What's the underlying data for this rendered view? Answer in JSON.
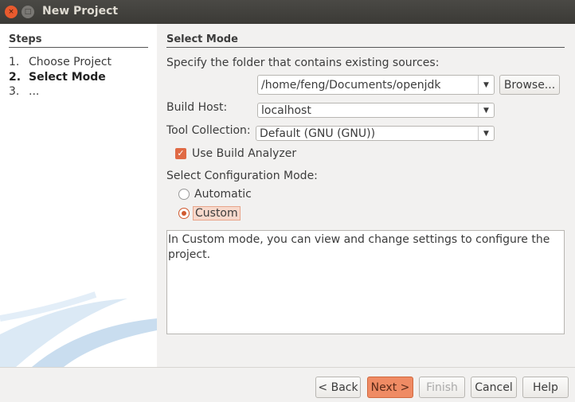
{
  "window": {
    "title": "New Project",
    "close_icon": "×",
    "maximize_icon": "□"
  },
  "steps": {
    "header": "Steps",
    "items": [
      {
        "num": "1.",
        "label": "Choose Project"
      },
      {
        "num": "2.",
        "label": "Select Mode"
      },
      {
        "num": "3.",
        "label": "..."
      }
    ]
  },
  "main": {
    "header": "Select Mode",
    "folder_label": "Specify the folder that contains existing sources:",
    "folder_value": "/home/feng/Documents/openjdk",
    "browse": "Browse...",
    "build_host_label": "Build Host:",
    "build_host_value": "localhost",
    "tool_collection_label": "Tool Collection:",
    "tool_collection_value": "Default (GNU (GNU))",
    "use_build_analyzer": "Use Build Analyzer",
    "use_build_analyzer_checked": true,
    "config_mode_label": "Select Configuration Mode:",
    "modes": [
      {
        "label": "Automatic",
        "selected": false
      },
      {
        "label": "Custom",
        "selected": true
      }
    ],
    "description": "In Custom mode, you can view and change settings to configure the project."
  },
  "buttons": {
    "back": "< Back",
    "next": "Next >",
    "finish": "Finish",
    "cancel": "Cancel",
    "help": "Help"
  },
  "colors": {
    "accent": "#e06a45"
  }
}
